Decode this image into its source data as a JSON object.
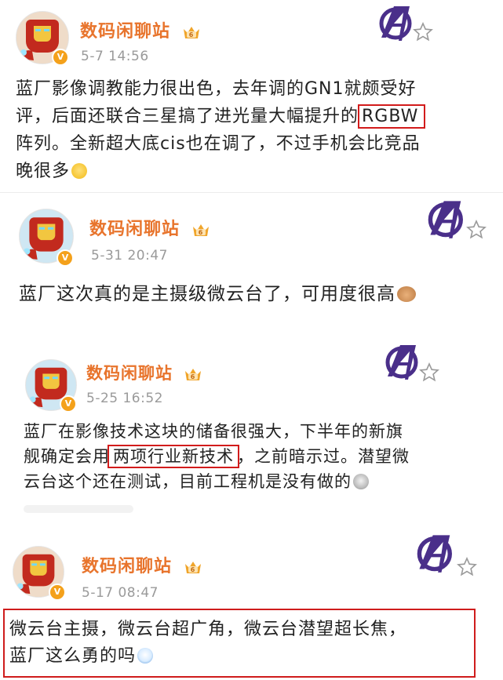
{
  "posts": [
    {
      "username": "数码闲聊站",
      "time": "5-7 14:56",
      "lines": [
        "蓝厂影像调教能力很出色，去年调的GN1就颇受好",
        "评，后面还联合三星搞了进光量大幅提升的",
        "阵列。全新超大底cis也在调了，不过手机会比竞品",
        "晚很多"
      ],
      "highlight": "RGBW"
    },
    {
      "username": "数码闲聊站",
      "time": "5-31 20:47",
      "lines": [
        "蓝厂这次真的是主摄级微云台了，可用度很高"
      ]
    },
    {
      "username": "数码闲聊站",
      "time": "5-25 16:52",
      "lines": [
        "蓝厂在影像技术这块的储备很强大，下半年的新旗",
        "舰确定会用",
        "，之前暗示过。潜望微",
        "云台这个还在测试，目前工程机是没有做的"
      ],
      "highlight": "两项行业新技术"
    },
    {
      "username": "数码闲聊站",
      "time": "5-17 08:47",
      "lines": [
        "微云台主摄，微云台超广角，微云台潜望超长焦，",
        "蓝厂这么勇的吗"
      ]
    }
  ],
  "badges": {
    "verified": "V",
    "level_crown": "6"
  },
  "colors": {
    "username": "#e8742c",
    "time": "#9a9a9a",
    "highlight_box": "#d21b1b",
    "verified_badge": "#f4a11b"
  },
  "icons": [
    "avengers-logo-icon",
    "star-outline-icon",
    "crown-badge-icon",
    "iron-man-avatar",
    "smile-emoji-icon",
    "jerry-mouse-emoji-icon",
    "cool-emoji-icon",
    "surprised-emoji-icon"
  ]
}
